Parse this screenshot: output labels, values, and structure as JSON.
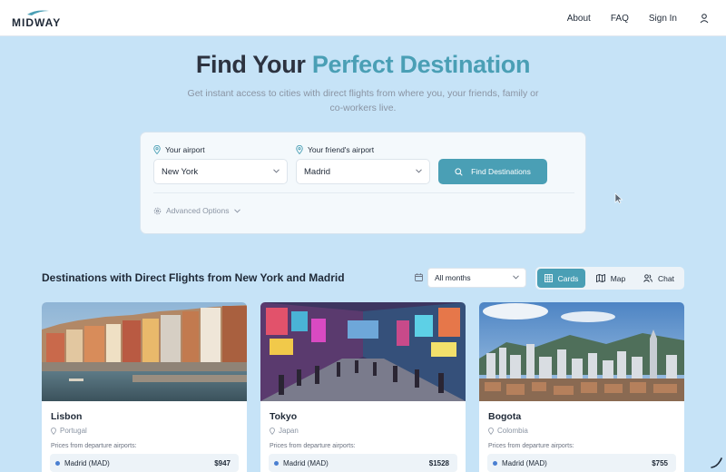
{
  "brand": {
    "name": "MIDWAY"
  },
  "nav": {
    "about": "About",
    "faq": "FAQ",
    "sign_in": "Sign In",
    "user_icon": "user-icon"
  },
  "hero": {
    "title_plain": "Find Your ",
    "title_accent": "Perfect Destination",
    "subtitle": "Get instant access to cities with direct flights from where you, your friends, family or co-workers live."
  },
  "search": {
    "your_airport_label": "Your airport",
    "your_airport_value": "New York",
    "friend_airport_label": "Your friend's airport",
    "friend_airport_value": "Madrid",
    "find_button": "Find Destinations",
    "advanced_options": "Advanced Options"
  },
  "results": {
    "title": "Destinations with Direct Flights from New York and Madrid",
    "month_filter": "All months",
    "views": {
      "cards": "Cards",
      "map": "Map",
      "chat": "Chat"
    },
    "active_view": "Cards",
    "cards": [
      {
        "city": "Lisbon",
        "country": "Portugal",
        "prices_label": "Prices from departure airports:",
        "airport": "Madrid (MAD)",
        "price": "$947"
      },
      {
        "city": "Tokyo",
        "country": "Japan",
        "prices_label": "Prices from departure airports:",
        "airport": "Madrid (MAD)",
        "price": "$1528"
      },
      {
        "city": "Bogota",
        "country": "Colombia",
        "prices_label": "Prices from departure airports:",
        "airport": "Madrid (MAD)",
        "price": "$755"
      }
    ]
  },
  "colors": {
    "accent": "#4a9fb5",
    "background": "#c6e3f7",
    "dot": "#4a7fd1"
  }
}
